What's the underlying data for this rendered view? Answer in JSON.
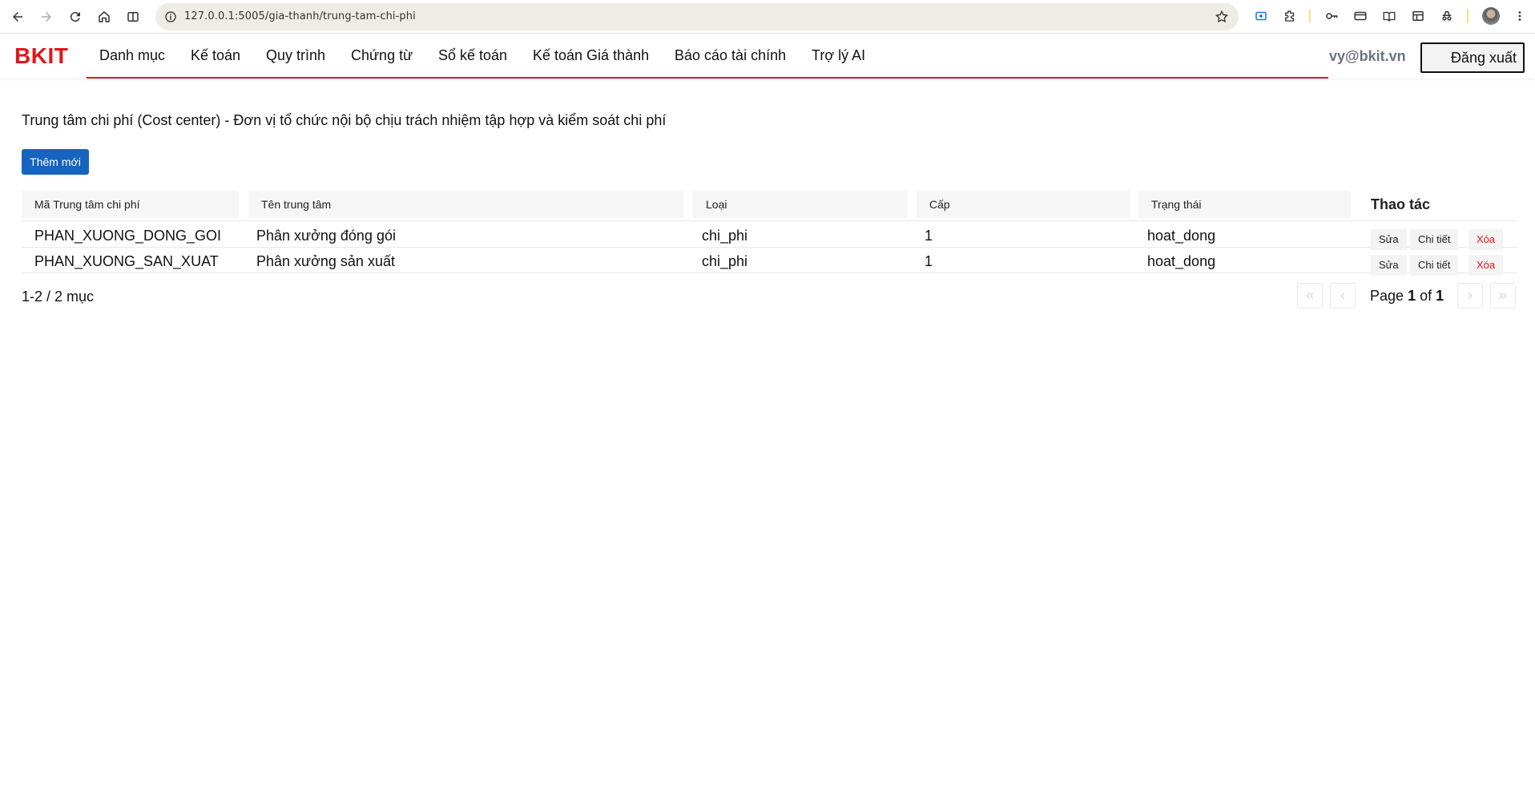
{
  "browser": {
    "url": "127.0.0.1:5005/gia-thanh/trung-tam-chi-phi"
  },
  "header": {
    "brand": "BKIT",
    "menu": [
      {
        "label": "Danh mục"
      },
      {
        "label": "Kế toán"
      },
      {
        "label": "Quy trình"
      },
      {
        "label": "Chứng từ"
      },
      {
        "label": "Sổ kế toán"
      },
      {
        "label": "Kế toán Giá thành"
      },
      {
        "label": "Báo cáo tài chính"
      },
      {
        "label": "Trợ lý AI"
      }
    ],
    "user_email": "vy@bkit.vn",
    "logout_label": "Đăng xuất",
    "accent_color": "#e0161c"
  },
  "page": {
    "title": "Trung tâm chi phí (Cost center) - Đơn vị tổ chức nội bộ chịu trách nhiệm tập hợp và kiểm soát chi phí",
    "add_label": "Thêm mới"
  },
  "table": {
    "columns": [
      "Mã Trung tâm chi phí",
      "Tên trung tâm",
      "Loại",
      "Cấp",
      "Trạng thái",
      "Thao tác"
    ],
    "rows": [
      {
        "code": "PHAN_XUONG_DONG_GOI",
        "name": "Phân xưởng đóng gói",
        "type": "chi_phi",
        "level": "1",
        "status": "hoat_dong"
      },
      {
        "code": "PHAN_XUONG_SAN_XUAT",
        "name": "Phân xưởng sản xuất",
        "type": "chi_phi",
        "level": "1",
        "status": "hoat_dong"
      }
    ],
    "actions": {
      "edit": "Sửa",
      "detail": "Chi tiết",
      "delete": "Xóa"
    }
  },
  "pagination": {
    "summary": "1-2 / 2 mục",
    "page_prefix": "Page",
    "current": "1",
    "of": "of",
    "total": "1"
  }
}
